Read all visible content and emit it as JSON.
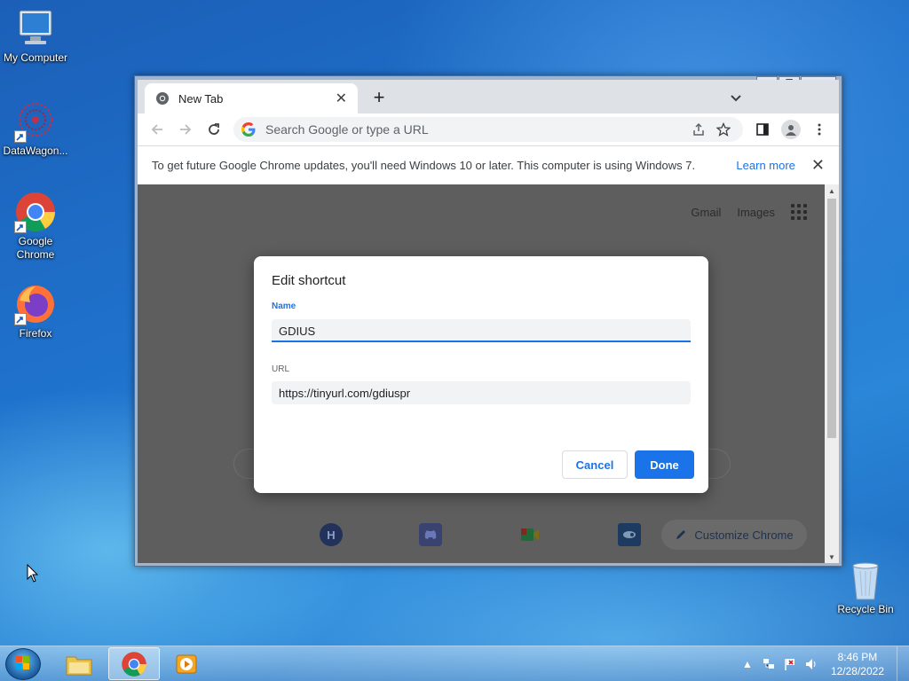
{
  "desktop": {
    "icons": [
      {
        "label": "My Computer"
      },
      {
        "label": "DataWagon..."
      },
      {
        "label": "Google Chrome"
      },
      {
        "label": "Firefox"
      },
      {
        "label": "Recycle Bin"
      }
    ]
  },
  "window": {
    "tab_title": "New Tab",
    "omnibox_placeholder": "Search Google or type a URL",
    "infobar": {
      "text": "To get future Google Chrome updates, you'll need Windows 10 or later. This computer is using Windows 7.",
      "link": "Learn more"
    },
    "ntp": {
      "links": [
        "Gmail",
        "Images"
      ],
      "customize_label": "Customize Chrome",
      "tile_letter": "H"
    }
  },
  "dialog": {
    "title": "Edit shortcut",
    "name_label": "Name",
    "name_value": "GDIUS",
    "url_label": "URL",
    "url_value": "https://tinyurl.com/gdiuspr",
    "cancel_label": "Cancel",
    "done_label": "Done"
  },
  "taskbar": {
    "time": "8:46 PM",
    "date": "12/28/2022"
  },
  "colors": {
    "accent": "#1a73e8",
    "desktop": "#1f72cc"
  }
}
